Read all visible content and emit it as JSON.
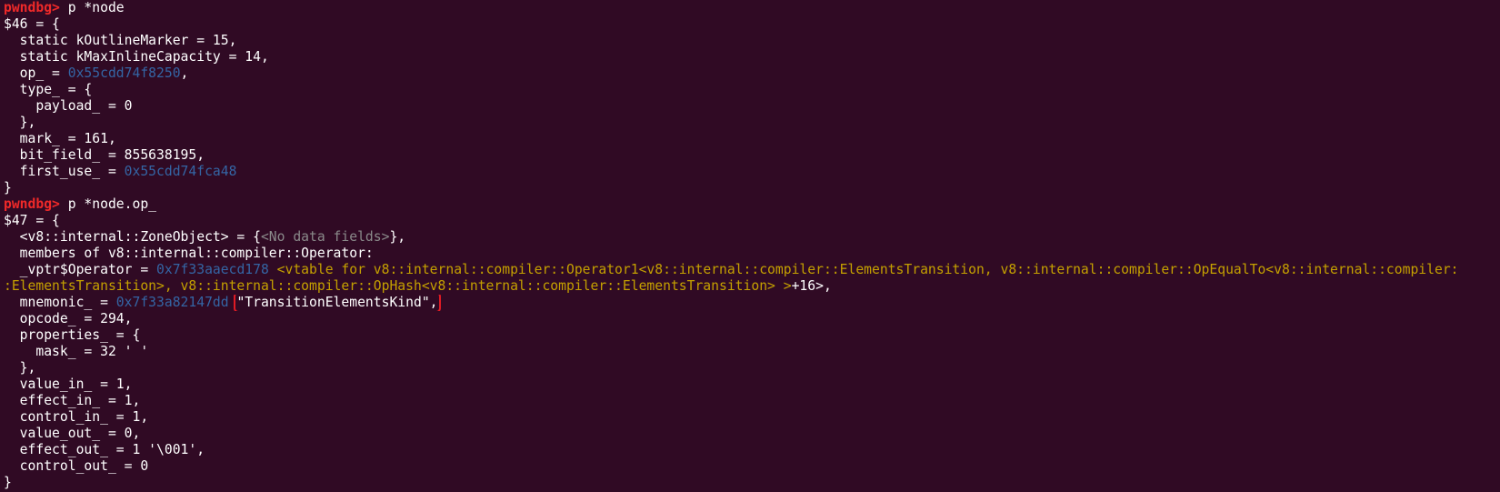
{
  "terminal": {
    "prompt": "pwndbg>",
    "cmd1": " p *node",
    "cmd2": " p *node.op_",
    "node": {
      "header": "$46 = {",
      "l1": "  static kOutlineMarker = 15,",
      "l2": "  static kMaxInlineCapacity = 14,",
      "l3_pre": "  op_ = ",
      "l3_addr": "0x55cdd74f8250",
      "l3_post": ",",
      "l4": "  type_ = {",
      "l5": "    payload_ = 0",
      "l6": "  },",
      "l7": "  mark_ = 161,",
      "l8": "  bit_field_ = 855638195,",
      "l9_pre": "  first_use_ = ",
      "l9_addr": "0x55cdd74fca48",
      "close": "}"
    },
    "op": {
      "header": "$47 = {",
      "zone_pre": "  <v8::internal::ZoneObject> = {",
      "zone_gray": "<No data fields>",
      "zone_post": "},",
      "members": "  members of v8::internal::compiler::Operator:",
      "vptr_pre": "  _vptr$Operator = ",
      "vptr_addr": "0x7f33aaecd178",
      "vptr_sym1": " <vtable for v8::internal::compiler::Operator1<v8::internal::compiler::ElementsTransition, v8::internal::compiler::OpEqualTo<v8::internal::compiler:",
      "vptr_sym2": ":ElementsTransition>, v8::internal::compiler::OpHash<v8::internal::compiler::ElementsTransition> >",
      "vptr_post": "+16>,",
      "mnemonic_pre": "  mnemonic_ = ",
      "mnemonic_addr": "0x7f33a82147dd",
      "mnemonic_val": "\"TransitionElementsKind\",",
      "opcode": "  opcode_ = 294,",
      "properties": "  properties_ = {",
      "mask": "    mask_ = 32 ' '",
      "prop_close": "  },",
      "value_in": "  value_in_ = 1,",
      "effect_in": "  effect_in_ = 1,",
      "control_in": "  control_in_ = 1,",
      "value_out": "  value_out_ = 0,",
      "effect_out": "  effect_out_ = 1 '\\001',",
      "control_out": "  control_out_ = 0",
      "close": "}"
    }
  },
  "colors": {
    "background": "#300a24",
    "prompt": "#ef2929",
    "address": "#3465a4",
    "symbol": "#c4a000",
    "highlight_box": "#e01b24"
  }
}
